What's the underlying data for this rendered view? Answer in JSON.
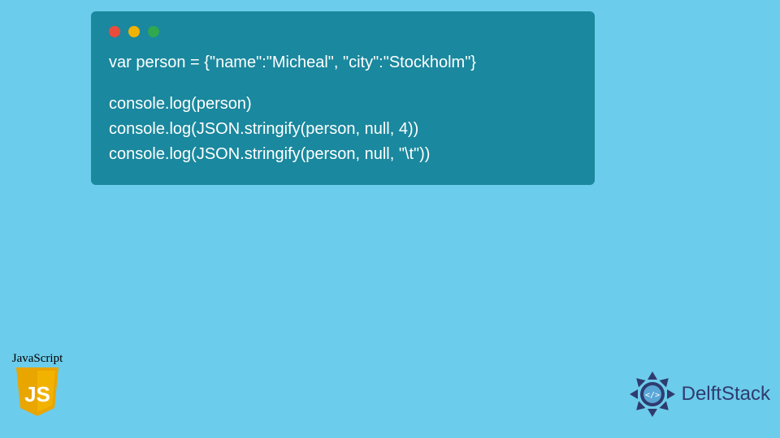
{
  "code": {
    "lines": [
      "var person = {\"name\":\"Micheal\", \"city\":\"Stockholm\"}",
      "",
      "console.log(person)",
      "console.log(JSON.stringify(person, null, 4))",
      "console.log(JSON.stringify(person, null, \"\\t\"))"
    ]
  },
  "badge": {
    "label": "JavaScript",
    "shield_text": "JS"
  },
  "brand": {
    "name": "DelftStack"
  },
  "colors": {
    "bg": "#6CCCEB",
    "code_bg": "#1A889E",
    "code_text": "#FFFFFF",
    "brand_text": "#2F3B6F",
    "shield_fill": "#E9A500"
  }
}
